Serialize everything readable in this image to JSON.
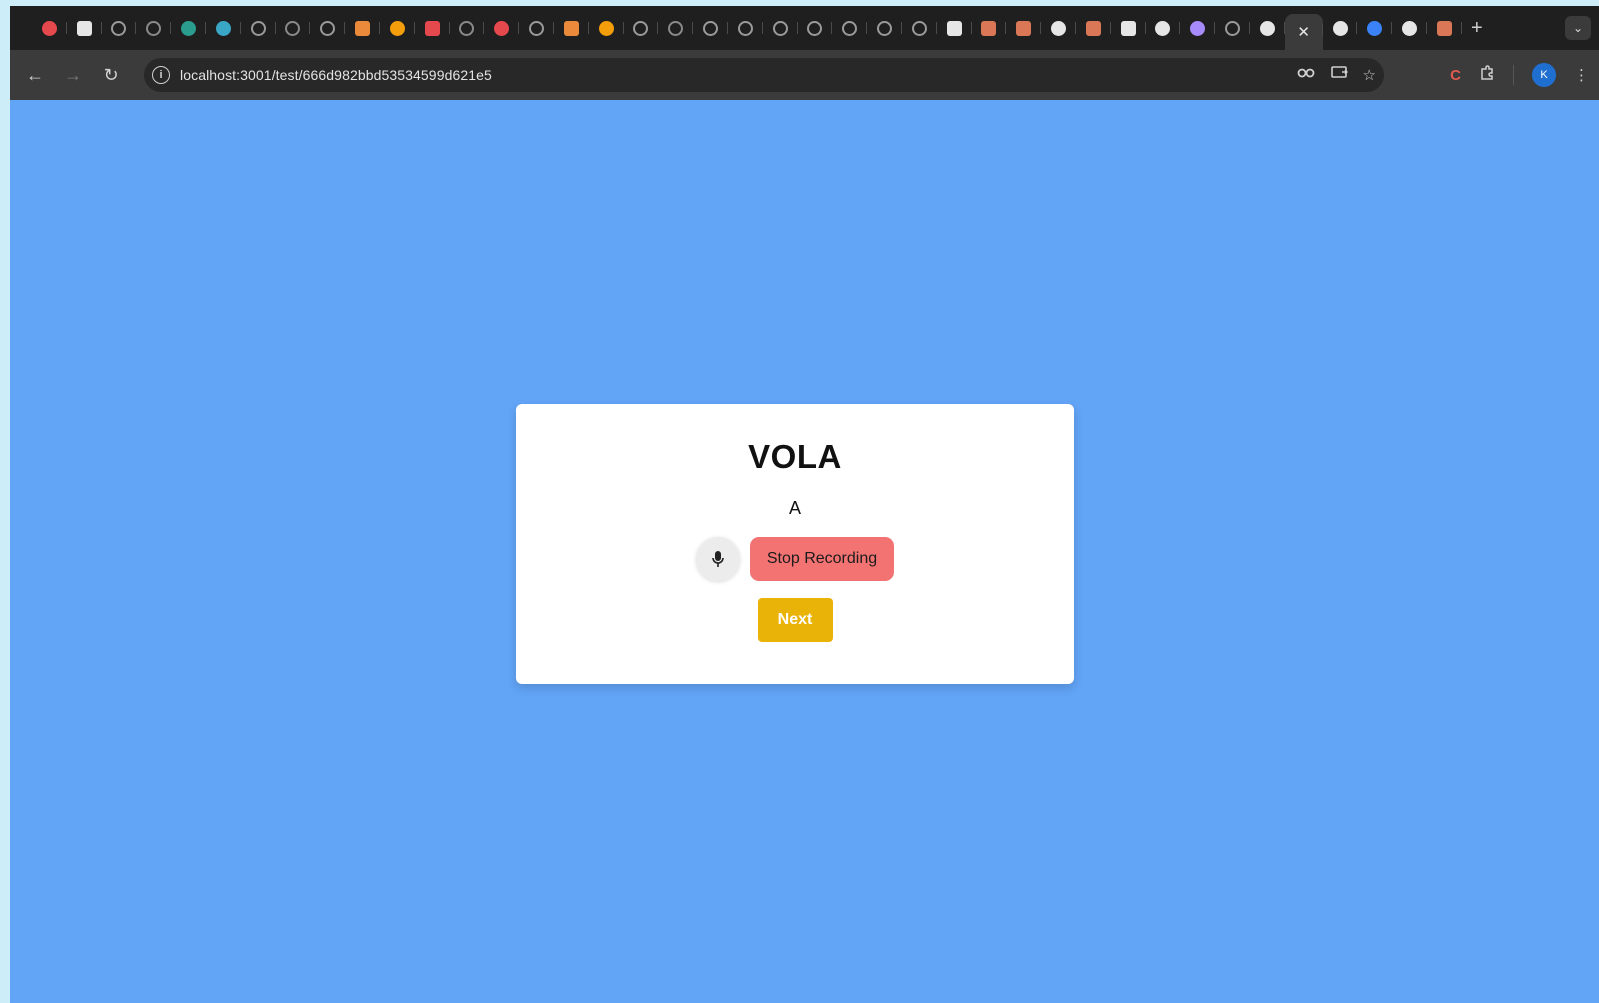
{
  "browser": {
    "tabs": [
      {
        "icon": "red-circle-icon",
        "color": "#e5484d"
      },
      {
        "icon": "chatgpt-icon",
        "color": "#e6e6e6"
      },
      {
        "icon": "globe-icon",
        "color": "#9a9a9a"
      },
      {
        "icon": "info-circle-icon",
        "color": "#8a8a8a"
      },
      {
        "icon": "grid-icon",
        "color": "#2a9d8f"
      },
      {
        "icon": "grid-icon",
        "color": "#3aa7c7"
      },
      {
        "icon": "globe-icon",
        "color": "#9a9a9a"
      },
      {
        "icon": "info-circle-icon",
        "color": "#8a8a8a"
      },
      {
        "icon": "openai-icon",
        "color": "#9a9a9a"
      },
      {
        "icon": "gmail-icon",
        "color": "#ea8a3a"
      },
      {
        "icon": "infinity-icon",
        "color": "#f59e0b"
      },
      {
        "icon": "youtube-icon",
        "color": "#e5484d"
      },
      {
        "icon": "info-circle-icon",
        "color": "#8a8a8a"
      },
      {
        "icon": "red-circle-icon",
        "color": "#e5484d"
      },
      {
        "icon": "gear-icon",
        "color": "#9a9a9a"
      },
      {
        "icon": "gmail-icon",
        "color": "#ea8a3a"
      },
      {
        "icon": "infinity-icon",
        "color": "#f59e0b"
      },
      {
        "icon": "openai-icon",
        "color": "#9a9a9a"
      },
      {
        "icon": "info-circle-icon",
        "color": "#8a8a8a"
      },
      {
        "icon": "gear-icon",
        "color": "#9a9a9a"
      },
      {
        "icon": "gear-icon",
        "color": "#9a9a9a"
      },
      {
        "icon": "circle-arrow-icon",
        "color": "#9a9a9a"
      },
      {
        "icon": "circle-arrow-icon",
        "color": "#9a9a9a"
      },
      {
        "icon": "openai-icon",
        "color": "#9a9a9a"
      },
      {
        "icon": "openai-icon",
        "color": "#9a9a9a"
      },
      {
        "icon": "gear-icon",
        "color": "#9a9a9a"
      },
      {
        "icon": "chatgpt-icon",
        "color": "#e6e6e6"
      },
      {
        "icon": "claude-icon",
        "color": "#d97757"
      },
      {
        "icon": "claude-icon",
        "color": "#d97757"
      },
      {
        "icon": "google-icon",
        "color": "#e6e6e6"
      },
      {
        "icon": "claude-icon",
        "color": "#d97757"
      },
      {
        "icon": "chatgpt-icon",
        "color": "#e6e6e6"
      },
      {
        "icon": "dots-icon",
        "color": "#e6e6e6"
      },
      {
        "icon": "gem-icon",
        "color": "#a78bfa"
      },
      {
        "icon": "globe-icon",
        "color": "#9a9a9a"
      },
      {
        "icon": "github-icon",
        "color": "#e6e6e6"
      }
    ],
    "tabs_after": [
      {
        "icon": "puzzle-icon",
        "color": "#e6e6e6"
      },
      {
        "icon": "minus-icon",
        "color": "#3b82f6"
      },
      {
        "icon": "github-icon",
        "color": "#e6e6e6"
      },
      {
        "icon": "claude-icon",
        "color": "#d97757"
      }
    ],
    "active_tab_close": "✕",
    "new_tab": "+",
    "tab_search": "⌄",
    "back": "←",
    "forward": "→",
    "reload": "↻",
    "site_info": "i",
    "url": "localhost:3001/test/666d982bbd53534599d621e5",
    "profile_initial": "K"
  },
  "card": {
    "word": "VOLA",
    "letter": "A",
    "stop_label": "Stop Recording",
    "next_label": "Next"
  },
  "colors": {
    "page_background": "#62a4f6",
    "stop_button": "#f37373",
    "next_button": "#eab308"
  }
}
